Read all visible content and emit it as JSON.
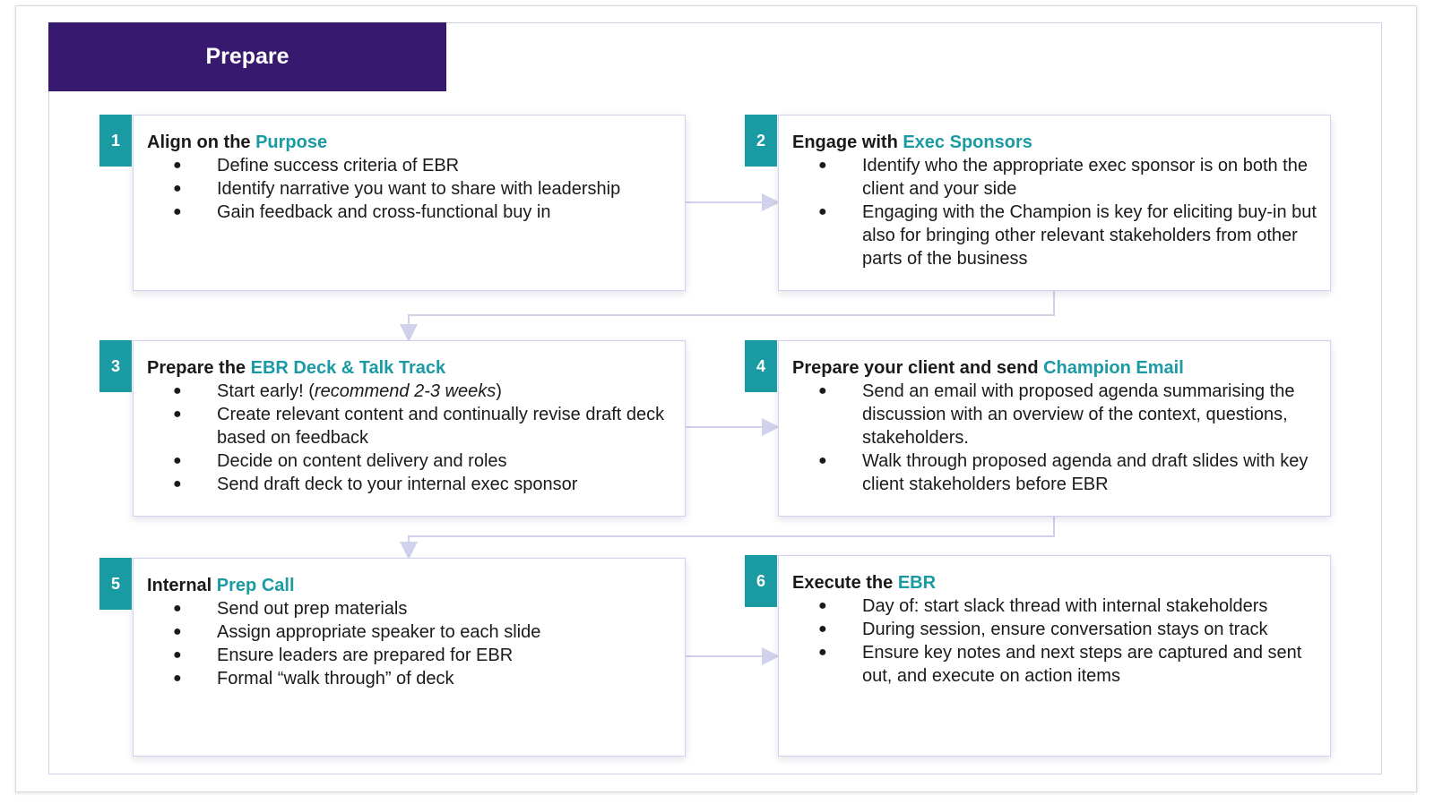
{
  "header": {
    "title": "Prepare"
  },
  "colors": {
    "header_bg": "#37196f",
    "accent": "#1a9aa3",
    "connector": "#cfd2ea"
  },
  "steps": [
    {
      "number": "1",
      "title_prefix": "Align on the ",
      "title_accent": "Purpose",
      "title_suffix": "",
      "bullets": [
        {
          "text": "Define success criteria of EBR"
        },
        {
          "text": "Identify narrative you want to share with leadership"
        },
        {
          "text": "Gain feedback and cross-functional buy in"
        }
      ]
    },
    {
      "number": "2",
      "title_prefix": "Engage with ",
      "title_accent": "Exec Sponsors",
      "title_suffix": "",
      "bullets": [
        {
          "text": "Identify who the appropriate exec sponsor is on both the client and your side"
        },
        {
          "text": "Engaging with the Champion is key for eliciting buy-in but also for bringing other relevant stakeholders from other parts of the business"
        }
      ]
    },
    {
      "number": "3",
      "title_prefix": "Prepare the ",
      "title_accent": "EBR Deck & Talk Track",
      "title_suffix": "",
      "bullets": [
        {
          "text": "Start early! (",
          "italic": "recommend 2-3 weeks",
          "after": ")"
        },
        {
          "text": "Create relevant content and continually revise draft deck based on feedback"
        },
        {
          "text": "Decide on content delivery and roles"
        },
        {
          "text": "Send draft deck to your internal exec sponsor"
        }
      ]
    },
    {
      "number": "4",
      "title_prefix": "Prepare your client and send ",
      "title_accent": "Champion Email",
      "title_suffix": "",
      "bullets": [
        {
          "text": "Send an email with proposed agenda summarising the discussion with an overview of the context, questions, stakeholders."
        },
        {
          "text": "Walk through proposed agenda and draft slides with key client stakeholders before EBR"
        }
      ]
    },
    {
      "number": "5",
      "title_prefix": "Internal ",
      "title_accent": "Prep Call",
      "title_suffix": "",
      "bullets": [
        {
          "text": "Send out prep materials"
        },
        {
          "text": "Assign appropriate speaker to each slide"
        },
        {
          "text": "Ensure leaders are prepared for EBR"
        },
        {
          "text": "Formal “walk through” of deck"
        }
      ]
    },
    {
      "number": "6",
      "title_prefix": "Execute the ",
      "title_accent": "EBR",
      "title_suffix": "",
      "bullets": [
        {
          "text": "Day of: start slack thread with internal stakeholders"
        },
        {
          "text": "During session, ensure conversation stays on track"
        },
        {
          "text": "Ensure key notes and next steps are captured and sent out, and execute on action items"
        }
      ]
    }
  ]
}
